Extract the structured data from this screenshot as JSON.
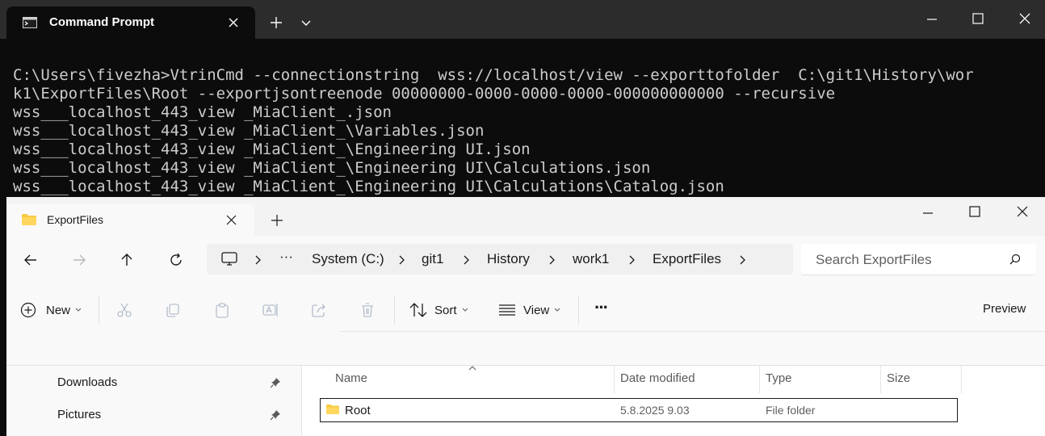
{
  "terminal": {
    "tab_title": "Command Prompt",
    "output_lines": [
      "C:\\Users\\fivezha>VtrinCmd --connectionstring  wss://localhost/view --exporttofolder  C:\\git1\\History\\wor",
      "k1\\ExportFiles\\Root --exportjsontreenode 00000000-0000-0000-0000-000000000000 --recursive",
      "wss___localhost_443_view _MiaClient_.json",
      "wss___localhost_443_view _MiaClient_\\Variables.json",
      "wss___localhost_443_view _MiaClient_\\Engineering UI.json",
      "wss___localhost_443_view _MiaClient_\\Engineering UI\\Calculations.json",
      "wss___localhost_443_view _MiaClient_\\Engineering UI\\Calculations\\Catalog.json"
    ]
  },
  "explorer": {
    "tab_title": "ExportFiles",
    "breadcrumb": [
      "System (C:)",
      "git1",
      "History",
      "work1",
      "ExportFiles"
    ],
    "breadcrumb_overflow": "···",
    "search": {
      "placeholder": "Search ExportFiles"
    },
    "toolbar": {
      "new_label": "New",
      "sort_label": "Sort",
      "view_label": "View",
      "more_label": "···",
      "preview_label": "Preview"
    },
    "sidebar": {
      "items": [
        {
          "label": "Downloads",
          "pinned": true
        },
        {
          "label": "Pictures",
          "pinned": true
        }
      ]
    },
    "columns": {
      "name": "Name",
      "date": "Date modified",
      "type": "Type",
      "size": "Size"
    },
    "rows": [
      {
        "name": "Root",
        "date": "5.8.2025 9.03",
        "type": "File folder",
        "size": ""
      }
    ]
  },
  "colors": {
    "terminal_bg": "#0c0c0c",
    "terminal_titlebar": "#2c2c2c",
    "terminal_text": "#cccccc",
    "explorer_bg": "#f9f9f9",
    "folder_yellow": "#f8c943",
    "accent": "#1a1a1a"
  }
}
